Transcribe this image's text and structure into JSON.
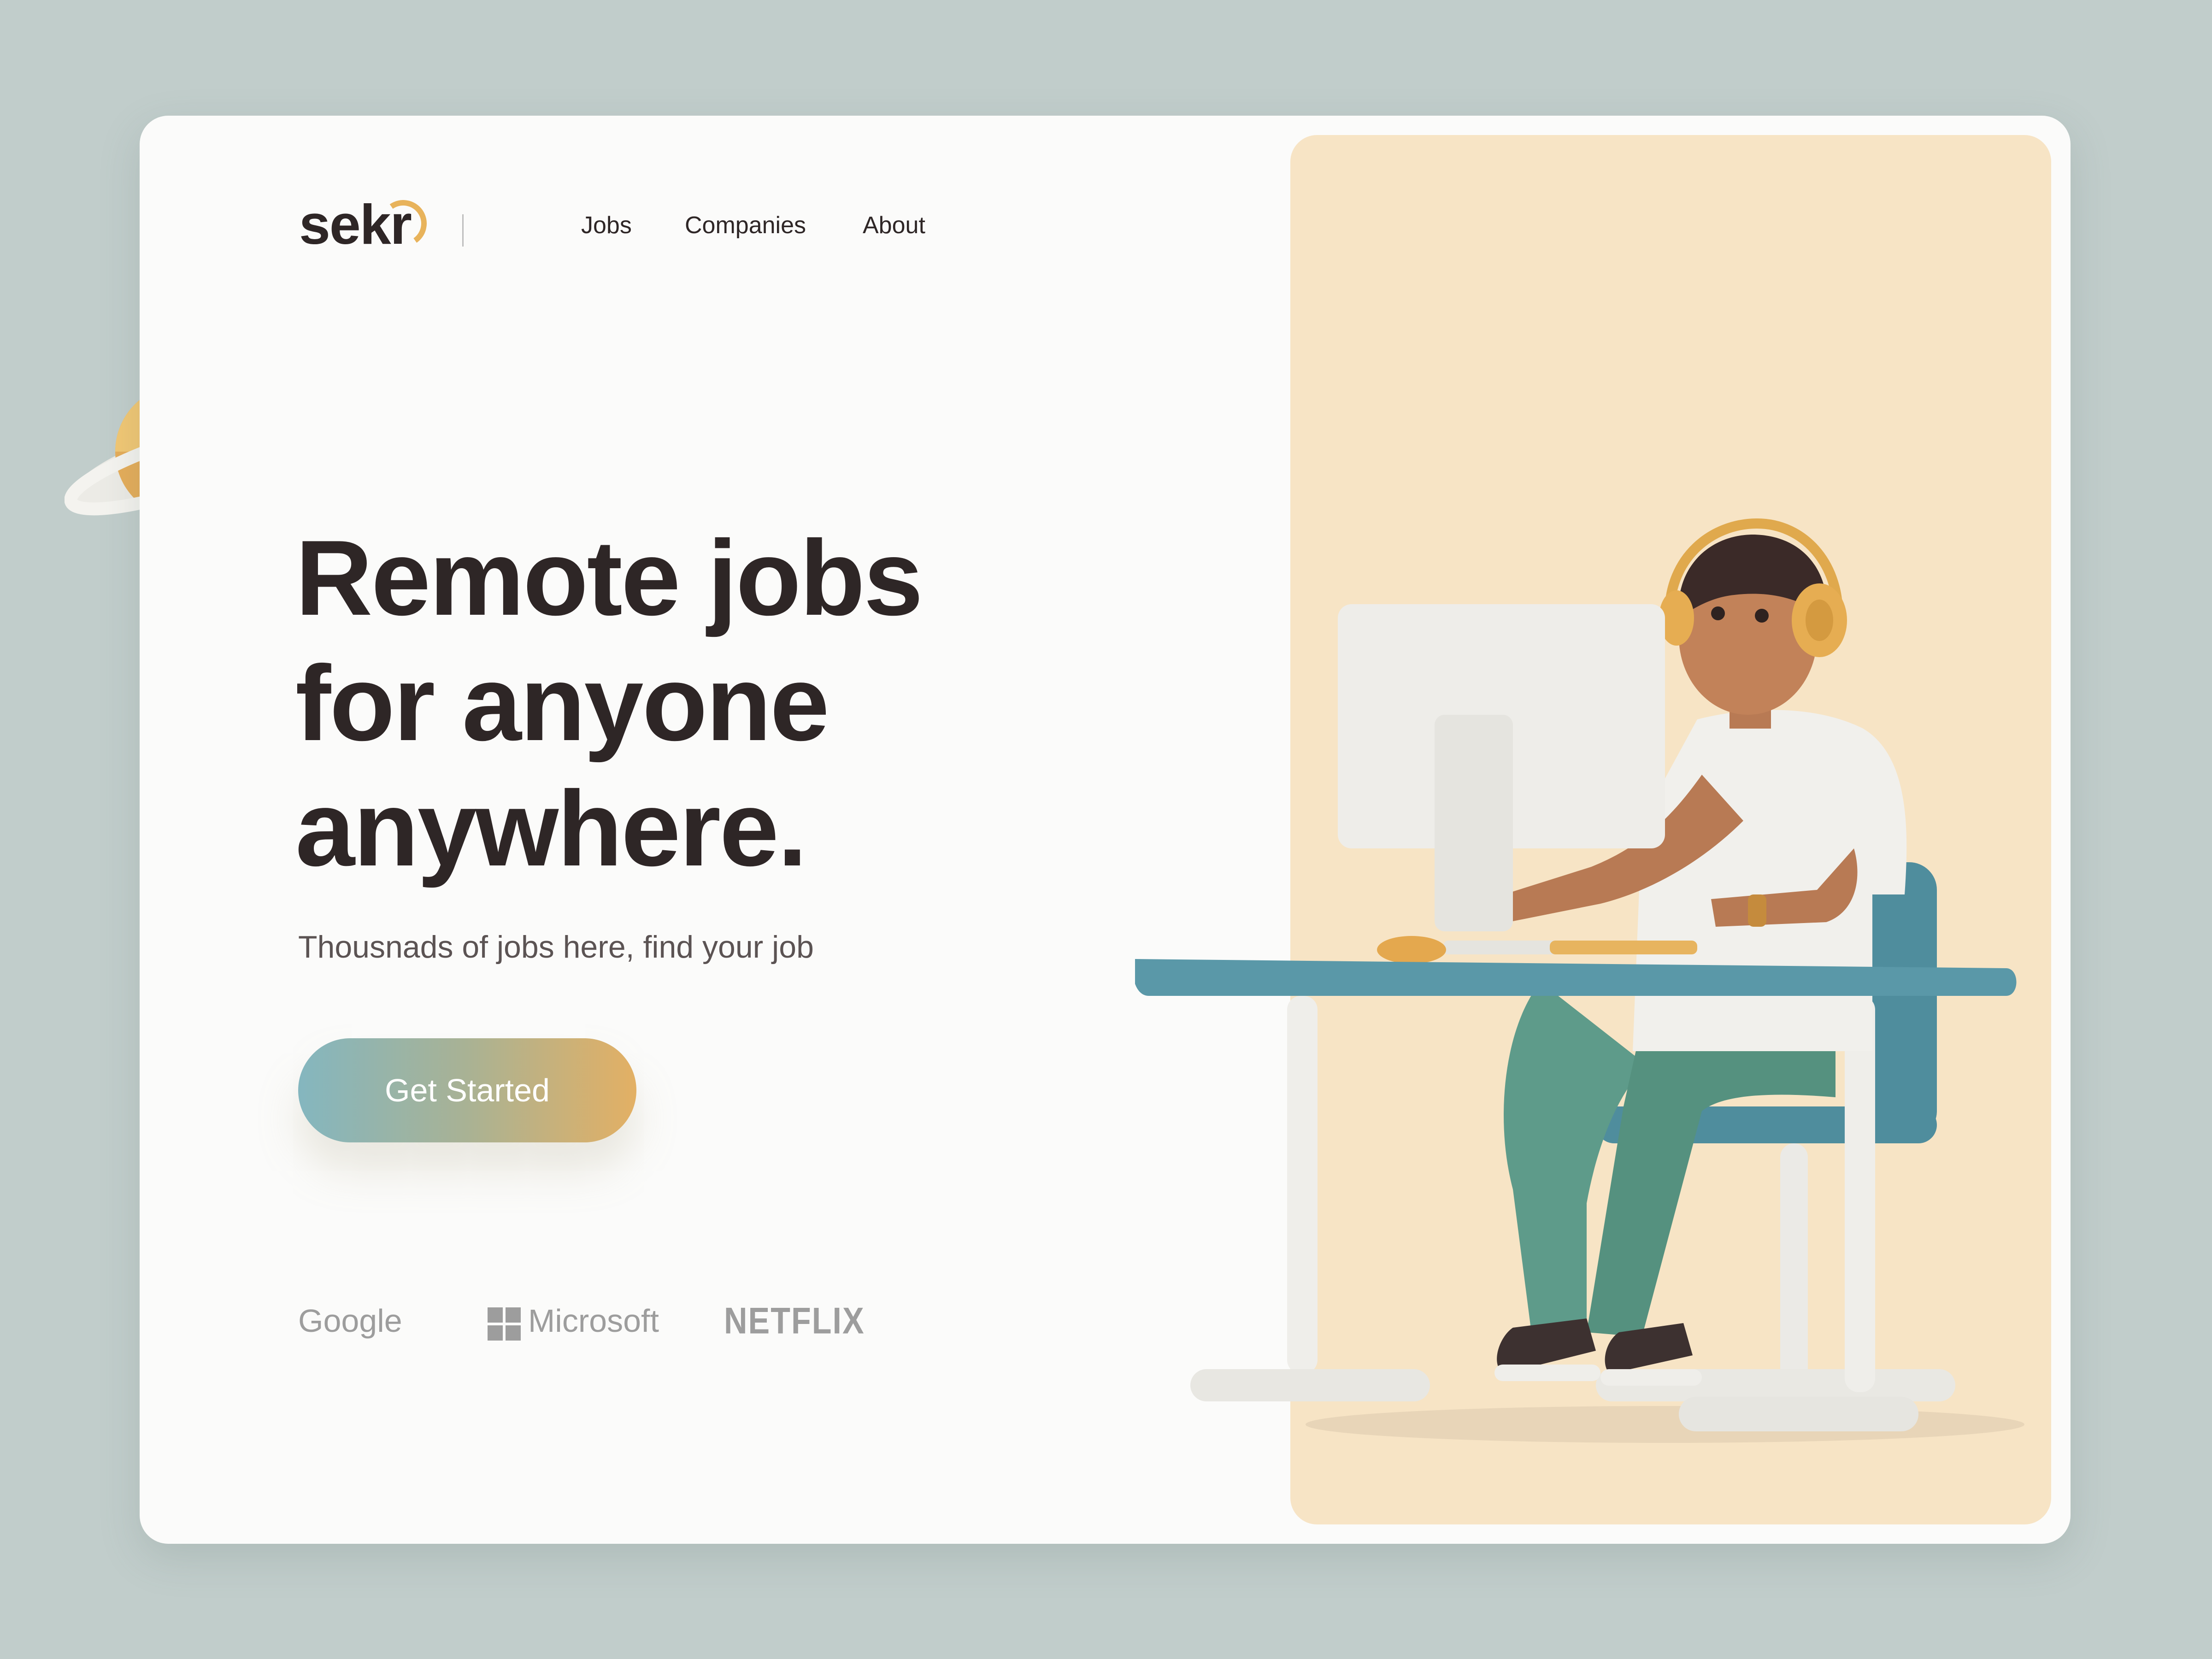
{
  "brand": {
    "logo_text": "sekr"
  },
  "nav": {
    "items": [
      "Jobs",
      "Companies",
      "About"
    ]
  },
  "hero": {
    "headline_lines": [
      "Remote jobs",
      "for anyone",
      "anywhere."
    ],
    "subtitle": "Thousnads of jobs here, find your job",
    "cta_label": "Get Started"
  },
  "partners": [
    "Google",
    "Microsoft",
    "NETFLIX"
  ],
  "colors": {
    "page_bg": "#c1cdcb",
    "card_bg": "#fbfbfa",
    "panel_bg": "#f7e4c5",
    "text_dark": "#2e2626",
    "accent_orange": "#e3b064",
    "accent_teal": "#84b6bf",
    "desk_blue": "#5a98a8",
    "pants_green": "#5e9b8a"
  },
  "icons": [
    "planet-icon",
    "microsoft-logo-icon",
    "logo-arc-icon"
  ]
}
